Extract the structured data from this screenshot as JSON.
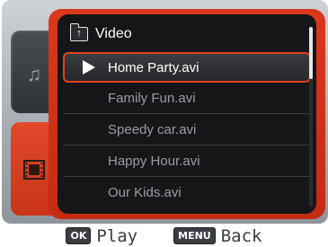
{
  "folder": {
    "icon": "folder-up-icon",
    "name": "Video"
  },
  "files": [
    {
      "name": "Home Party.avi",
      "selected": true
    },
    {
      "name": "Family Fun.avi",
      "selected": false
    },
    {
      "name": "Speedy car.avi",
      "selected": false
    },
    {
      "name": "Happy Hour.avi",
      "selected": false
    },
    {
      "name": "Our Kids.avi",
      "selected": false
    }
  ],
  "tabs": [
    {
      "name": "music",
      "icon": "music-note-icon",
      "glyph": "♫",
      "active": false
    },
    {
      "name": "video",
      "icon": "film-icon",
      "glyph": "🎞",
      "active": true
    }
  ],
  "hints": [
    {
      "key": "OK",
      "label": "Play"
    },
    {
      "key": "MENU",
      "label": "Back"
    }
  ],
  "colors": {
    "accent": "#d9381c",
    "selection_border": "#e3421f",
    "list_bg": "#141618"
  }
}
